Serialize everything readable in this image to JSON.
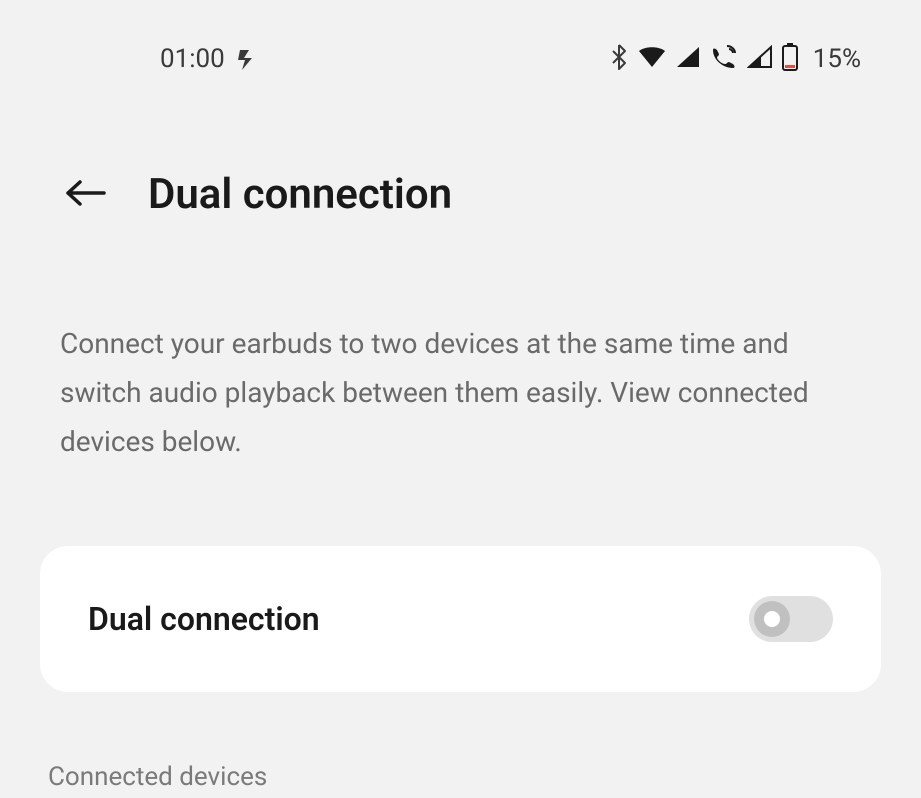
{
  "status_bar": {
    "time": "01:00",
    "battery_percent": "15%"
  },
  "header": {
    "title": "Dual connection"
  },
  "description": "Connect your earbuds to two devices at the same time and switch audio playback between them easily. View connected devices below.",
  "toggle_card": {
    "label": "Dual connection",
    "enabled": false
  },
  "sections": {
    "connected_devices_label": "Connected devices"
  }
}
